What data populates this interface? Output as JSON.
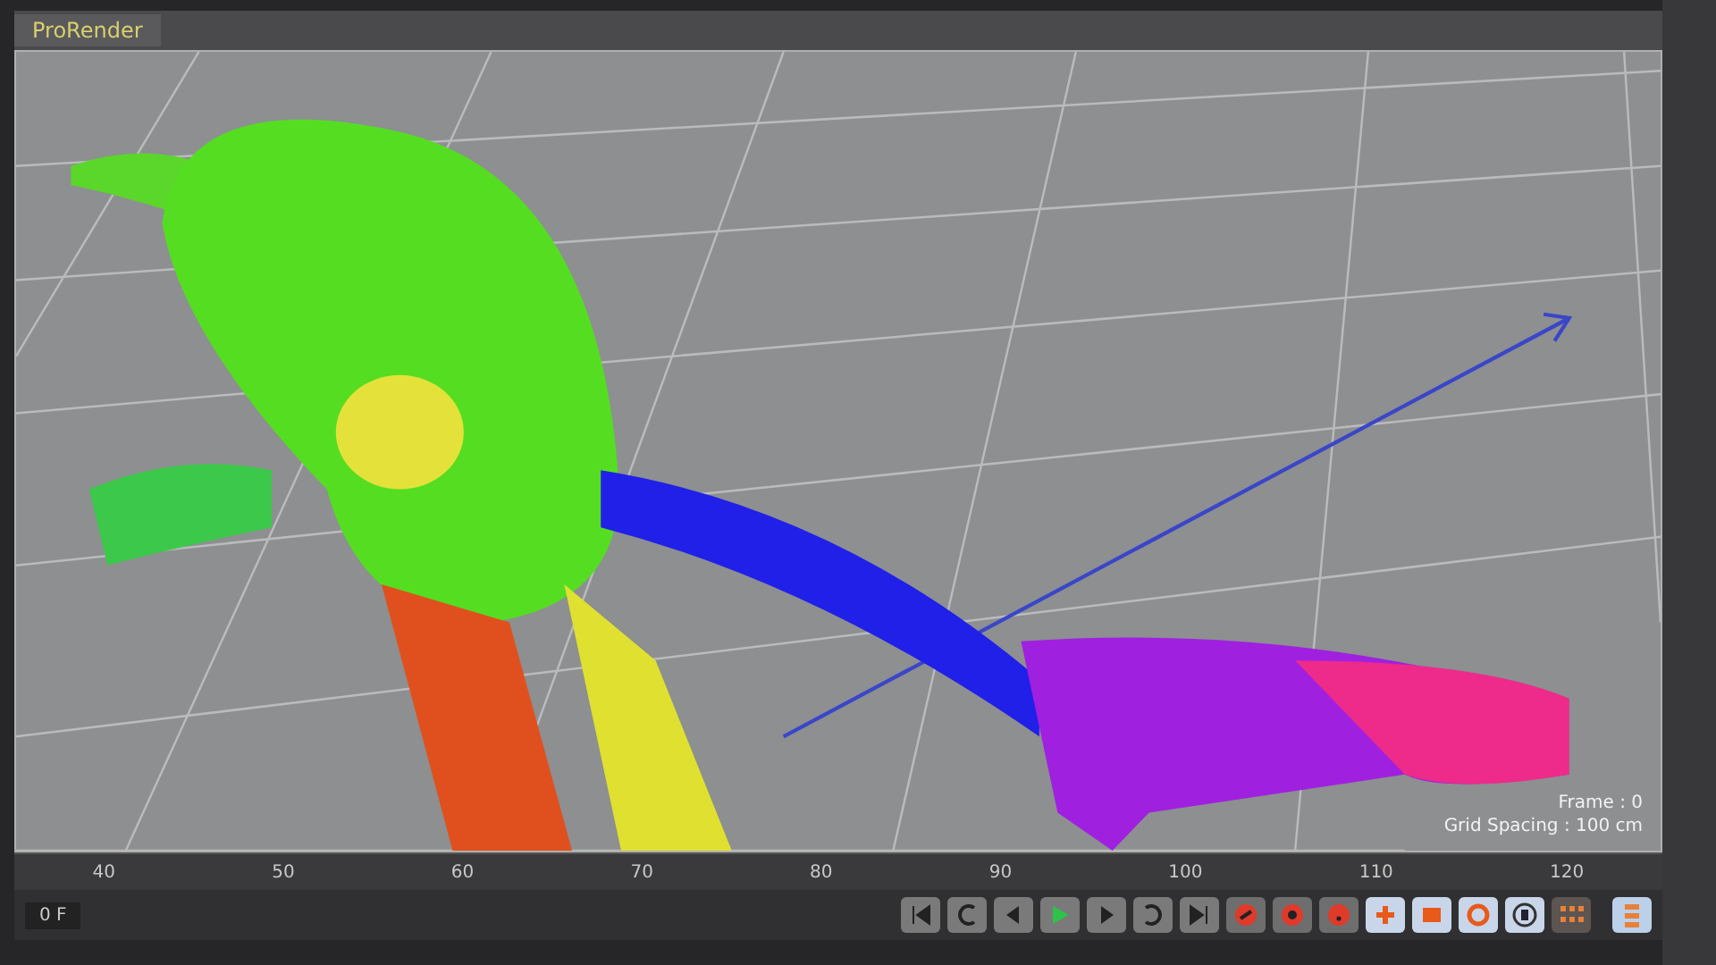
{
  "tab": {
    "label": "ProRender"
  },
  "viewport": {
    "hud": [
      {
        "label": "Frame : 0"
      },
      {
        "label": "Grid Spacing : 100 cm"
      }
    ]
  },
  "timeline": {
    "ticks": [
      "40",
      "50",
      "60",
      "70",
      "80",
      "90",
      "100",
      "110",
      "120"
    ],
    "frame_field": "0 F"
  }
}
